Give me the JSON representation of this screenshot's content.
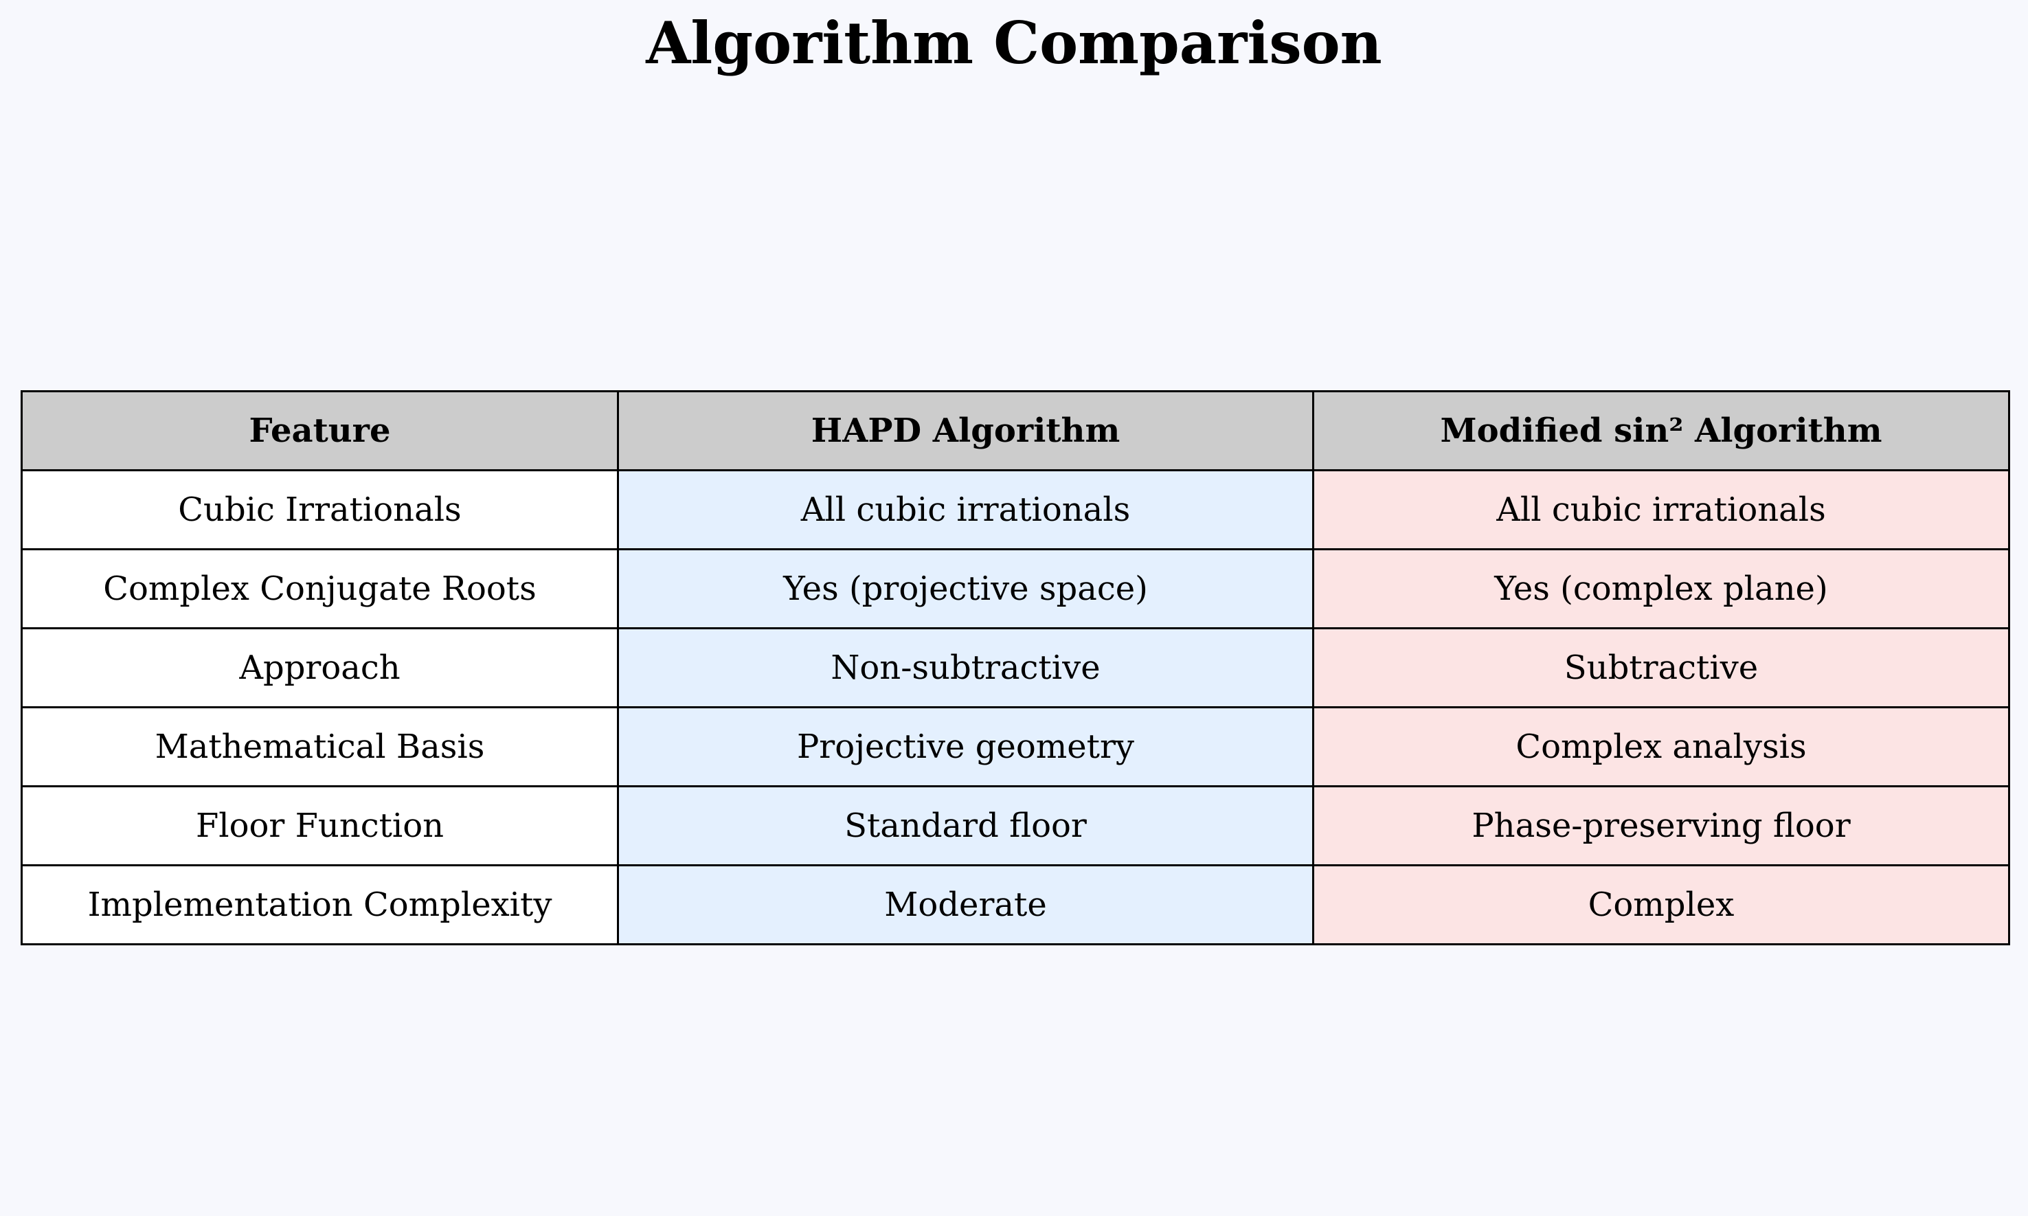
{
  "chart_data": {
    "type": "table",
    "title": "Algorithm Comparison",
    "columns": [
      "Feature",
      "HAPD Algorithm",
      "Modified sin² Algorithm"
    ],
    "rows": [
      [
        "Cubic Irrationals",
        "All cubic irrationals",
        "All cubic irrationals"
      ],
      [
        "Complex Conjugate Roots",
        "Yes (projective space)",
        "Yes (complex plane)"
      ],
      [
        "Approach",
        "Non-subtractive",
        "Subtractive"
      ],
      [
        "Mathematical Basis",
        "Projective geometry",
        "Complex analysis"
      ],
      [
        "Floor Function",
        "Standard floor",
        "Phase-preserving floor"
      ],
      [
        "Implementation Complexity",
        "Moderate",
        "Complex"
      ]
    ],
    "colors": {
      "background": "#f7f8fd",
      "header": "#cccccc",
      "feature_column": "#ffffff",
      "hapd_column": "#e4f0fe",
      "sin2_column": "#fce4e4"
    }
  }
}
